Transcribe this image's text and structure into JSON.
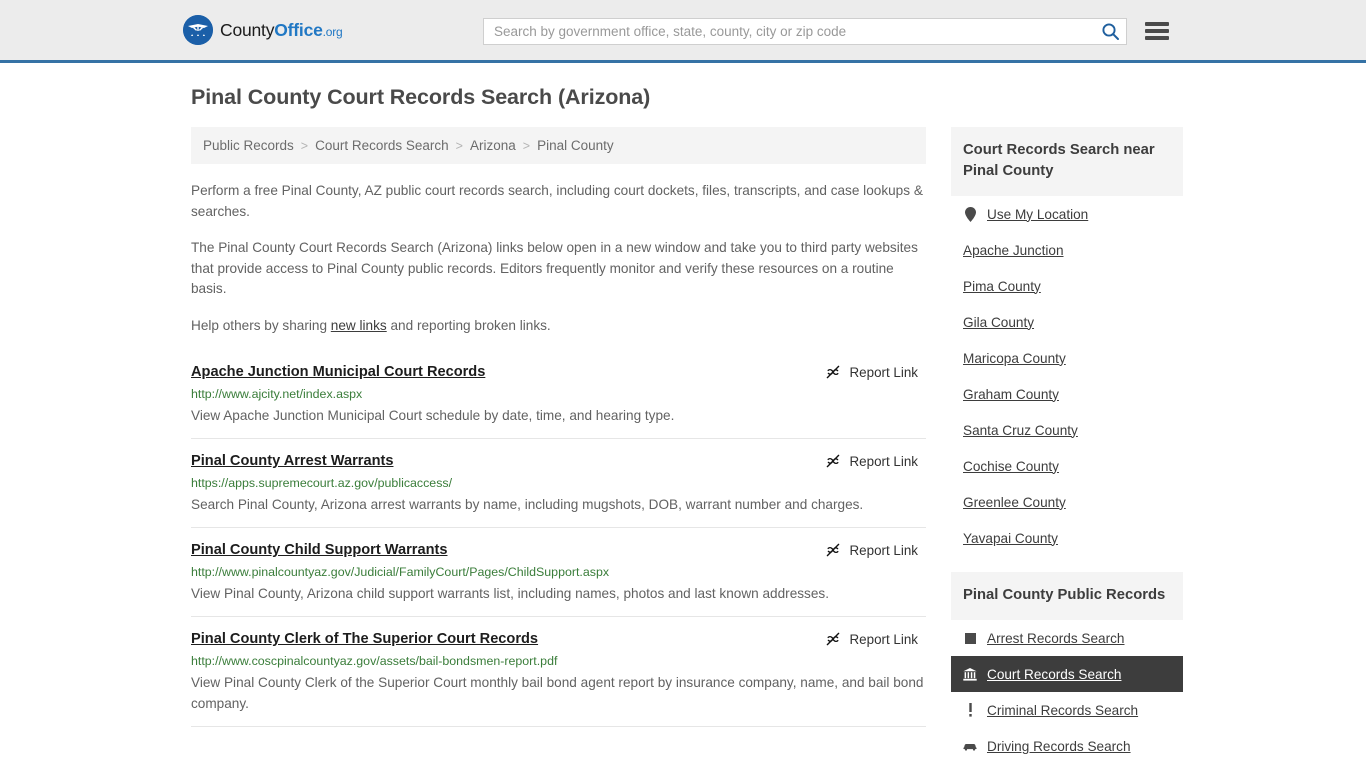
{
  "header": {
    "logo": {
      "text_part1": "County",
      "text_part2": "Office",
      "text_part3": ".org",
      "badge_icon": "eagle-shield-icon"
    },
    "search": {
      "placeholder": "Search by government office, state, county, city or zip code",
      "value": "",
      "button_icon": "search-icon"
    },
    "menu_icon": "hamburger-menu-icon"
  },
  "page_title": "Pinal County Court Records Search (Arizona)",
  "breadcrumb": {
    "separator": ">",
    "items": [
      {
        "label": "Public Records"
      },
      {
        "label": "Court Records Search"
      },
      {
        "label": "Arizona"
      },
      {
        "label": "Pinal County"
      }
    ]
  },
  "intro": {
    "p1": "Perform a free Pinal County, AZ public court records search, including court dockets, files, transcripts, and case lookups & searches.",
    "p2": "The Pinal County Court Records Search (Arizona) links below open in a new window and take you to third party websites that provide access to Pinal County public records. Editors frequently monitor and verify these resources on a routine basis.",
    "p3_before": "Help others by sharing ",
    "p3_link": "new links",
    "p3_after": " and reporting broken links."
  },
  "report_link_label": "Report Link",
  "report_link_icon": "broken-link-icon",
  "results": [
    {
      "title": "Apache Junction Municipal Court Records",
      "url": "http://www.ajcity.net/index.aspx",
      "description": "View Apache Junction Municipal Court schedule by date, time, and hearing type."
    },
    {
      "title": "Pinal County Arrest Warrants",
      "url": "https://apps.supremecourt.az.gov/publicaccess/",
      "description": "Search Pinal County, Arizona arrest warrants by name, including mugshots, DOB, warrant number and charges."
    },
    {
      "title": "Pinal County Child Support Warrants",
      "url": "http://www.pinalcountyaz.gov/Judicial/FamilyCourt/Pages/ChildSupport.aspx",
      "description": "View Pinal County, Arizona child support warrants list, including names, photos and last known addresses."
    },
    {
      "title": "Pinal County Clerk of The Superior Court Records",
      "url": "http://www.coscpinalcountyaz.gov/assets/bail-bondsmen-report.pdf",
      "description": "View Pinal County Clerk of the Superior Court monthly bail bond agent report by insurance company, name, and bail bond company."
    }
  ],
  "sidebar": {
    "nearby": {
      "title": "Court Records Search near Pinal County",
      "items": [
        {
          "label": "Use My Location",
          "icon": "map-pin-icon"
        },
        {
          "label": "Apache Junction",
          "icon": ""
        },
        {
          "label": "Pima County",
          "icon": ""
        },
        {
          "label": "Gila County",
          "icon": ""
        },
        {
          "label": "Maricopa County",
          "icon": ""
        },
        {
          "label": "Graham County",
          "icon": ""
        },
        {
          "label": "Santa Cruz County",
          "icon": ""
        },
        {
          "label": "Cochise County",
          "icon": ""
        },
        {
          "label": "Greenlee County",
          "icon": ""
        },
        {
          "label": "Yavapai County",
          "icon": ""
        }
      ]
    },
    "public_records": {
      "title": "Pinal County Public Records",
      "items": [
        {
          "label": "Arrest Records Search",
          "icon": "square-icon",
          "active": false
        },
        {
          "label": "Court Records Search",
          "icon": "courthouse-icon",
          "active": true
        },
        {
          "label": "Criminal Records Search",
          "icon": "exclamation-icon",
          "active": false
        },
        {
          "label": "Driving Records Search",
          "icon": "car-icon",
          "active": false
        }
      ]
    }
  },
  "colors": {
    "header_bg": "#ececec",
    "header_border": "#3572a5",
    "accent_blue": "#2178c4",
    "url_green": "#3a7d3a",
    "panel_bg": "#f4f4f4",
    "active_bg": "#3d3d3d"
  }
}
